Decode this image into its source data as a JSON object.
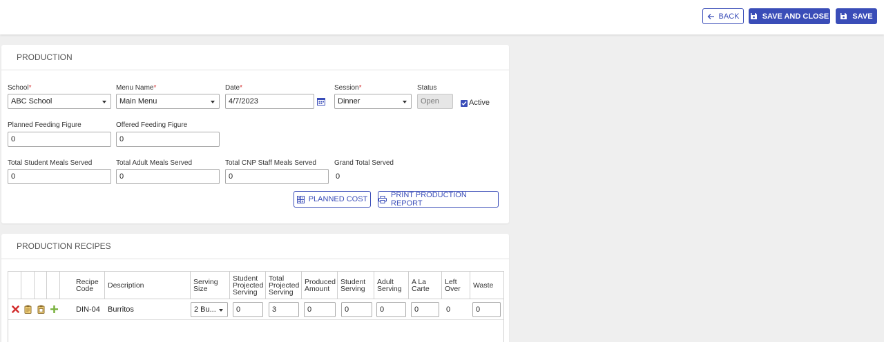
{
  "toolbar": {
    "back_label": "BACK",
    "save_close_label": "SAVE AND CLOSE",
    "save_label": "SAVE"
  },
  "production": {
    "title": "PRODUCTION",
    "school": {
      "label": "School",
      "value": "ABC School"
    },
    "menu_name": {
      "label": "Menu Name",
      "value": "Main Menu"
    },
    "date": {
      "label": "Date",
      "value": "4/7/2023"
    },
    "session": {
      "label": "Session",
      "value": "Dinner"
    },
    "status": {
      "label": "Status",
      "value": "Open"
    },
    "active": {
      "label": "Active",
      "checked": true
    },
    "planned_feeding": {
      "label": "Planned Feeding Figure",
      "value": "0"
    },
    "offered_feeding": {
      "label": "Offered Feeding Figure",
      "value": "0"
    },
    "total_student": {
      "label": "Total Student Meals Served",
      "value": "0"
    },
    "total_adult": {
      "label": "Total Adult Meals Served",
      "value": "0"
    },
    "total_cnp": {
      "label": "Total CNP Staff Meals Served",
      "value": "0"
    },
    "grand_total": {
      "label": "Grand Total Served",
      "value": "0"
    },
    "planned_cost_label": "PLANNED COST",
    "print_report_label": "PRINT PRODUCTION REPORT",
    "required_mark": "*"
  },
  "recipes": {
    "title": "PRODUCTION RECIPES",
    "columns": {
      "recipe_code": [
        "Recipe",
        "Code"
      ],
      "description": "Description",
      "serving_size": [
        "Serving",
        "Size"
      ],
      "student_projected": [
        "Student",
        "Projected",
        "Serving"
      ],
      "total_projected": [
        "Total",
        "Projected",
        "Serving"
      ],
      "produced": [
        "Produced",
        "Amount"
      ],
      "student_serving": [
        "Student",
        "Serving"
      ],
      "adult_serving": [
        "Adult",
        "Serving"
      ],
      "a_la_carte": [
        "A La",
        "Carte"
      ],
      "left_over": [
        "Left",
        "Over"
      ],
      "waste": "Waste"
    },
    "rows": [
      {
        "recipe_code": "DIN-04",
        "description": "Burritos",
        "serving_size": "2 Bu...",
        "student_projected": "0",
        "total_projected": "3",
        "produced": "0",
        "student_serving": "0",
        "adult_serving": "0",
        "a_la_carte": "0",
        "left_over": "0",
        "waste": "0"
      }
    ]
  },
  "icons": {
    "back": "arrow-left-icon",
    "save": "floppy-disk-icon",
    "calendar": "calendar-icon",
    "calculator": "calculator-icon",
    "printer": "printer-icon",
    "delete": "red-x-icon",
    "copy": "clipboard-icon",
    "paste": "clipboard-check-icon",
    "add": "green-plus-icon"
  },
  "colors": {
    "primary": "#3a4db8",
    "required": "#d32f2f",
    "delete": "#d32f2f",
    "add": "#7cb342",
    "clipboard": "#8a6a2a"
  }
}
